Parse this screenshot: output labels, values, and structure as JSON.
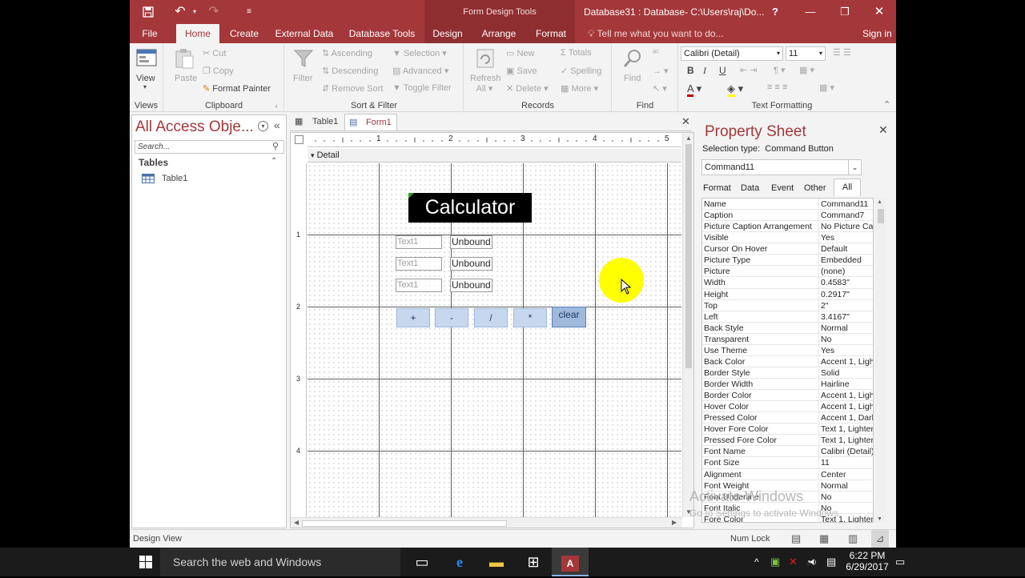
{
  "title_bar": {
    "context_label": "Form Design Tools",
    "window_title": "Database31 : Database- C:\\Users\\raj\\Do...",
    "help": "?",
    "minimize": "—",
    "restore": "❐",
    "close": "✕"
  },
  "ribbon_tabs": [
    "File",
    "Home",
    "Create",
    "External Data",
    "Database Tools",
    "Design",
    "Arrange",
    "Format"
  ],
  "tell_me": "Tell me what you want to do...",
  "sign_in": "Sign in",
  "ribbon": {
    "views": {
      "view": "View",
      "label": "Views"
    },
    "clipboard": {
      "paste": "Paste",
      "cut": "Cut",
      "copy": "Copy",
      "format_painter": "Format Painter",
      "label": "Clipboard"
    },
    "sort_filter": {
      "filter": "Filter",
      "ascending": "Ascending",
      "descending": "Descending",
      "remove_sort": "Remove Sort",
      "selection": "Selection",
      "advanced": "Advanced",
      "toggle_filter": "Toggle Filter",
      "label": "Sort & Filter"
    },
    "records": {
      "refresh": "Refresh",
      "refresh2": "All",
      "new": "New",
      "save": "Save",
      "delete": "Delete",
      "totals": "Totals",
      "spelling": "Spelling",
      "more": "More",
      "label": "Records"
    },
    "find": {
      "find": "Find",
      "label": "Find"
    },
    "text_formatting": {
      "font": "Calibri (Detail)",
      "size": "11",
      "bold": "B",
      "italic": "I",
      "underline": "U",
      "label": "Text Formatting"
    }
  },
  "nav_pane": {
    "header": "All Access Obje...",
    "search_placeholder": "Search...",
    "section": "Tables",
    "items": [
      "Table1"
    ]
  },
  "doc_tabs": [
    "Table1",
    "Form1"
  ],
  "ruler": [
    "1",
    "2",
    "3",
    "4",
    "5"
  ],
  "vruler": [
    "1",
    "2",
    "3",
    "4"
  ],
  "form": {
    "section": "Detail",
    "title_label": "Calculator",
    "labels": [
      "Text1",
      "Text1",
      "Text1"
    ],
    "textboxes": [
      "Unbound",
      "Unbound",
      "Unbound"
    ],
    "buttons": [
      "+",
      "-",
      "/",
      "*",
      "clear"
    ]
  },
  "property_sheet": {
    "title": "Property Sheet",
    "selection_type_label": "Selection type:",
    "selection_type": "Command Button",
    "selected_control": "Command11",
    "tabs": [
      "Format",
      "Data",
      "Event",
      "Other",
      "All"
    ],
    "rows": [
      [
        "Name",
        "Command11"
      ],
      [
        "Caption",
        "Command7"
      ],
      [
        "Picture Caption Arrangement",
        "No Picture Cap"
      ],
      [
        "Visible",
        "Yes"
      ],
      [
        "Cursor On Hover",
        "Default"
      ],
      [
        "Picture Type",
        "Embedded"
      ],
      [
        "Picture",
        "(none)"
      ],
      [
        "Width",
        "0.4583\""
      ],
      [
        "Height",
        "0.2917\""
      ],
      [
        "Top",
        "2\""
      ],
      [
        "Left",
        "3.4167\""
      ],
      [
        "Back Style",
        "Normal"
      ],
      [
        "Transparent",
        "No"
      ],
      [
        "Use Theme",
        "Yes"
      ],
      [
        "Back Color",
        "Accent 1, Ligh"
      ],
      [
        "Border Style",
        "Solid"
      ],
      [
        "Border Width",
        "Hairline"
      ],
      [
        "Border Color",
        "Accent 1, Ligh"
      ],
      [
        "Hover Color",
        "Accent 1, Ligh"
      ],
      [
        "Pressed Color",
        "Accent 1, Dark"
      ],
      [
        "Hover Fore Color",
        "Text 1, Lighter"
      ],
      [
        "Pressed Fore Color",
        "Text 1, Lighter"
      ],
      [
        "Font Name",
        "Calibri (Detail)"
      ],
      [
        "Font Size",
        "11"
      ],
      [
        "Alignment",
        "Center"
      ],
      [
        "Font Weight",
        "Normal"
      ],
      [
        "Font Underline",
        "No"
      ],
      [
        "Font Italic",
        "No"
      ],
      [
        "Fore Color",
        "Text 1, Lighter"
      ]
    ]
  },
  "watermark": {
    "line1": "Activate Windows",
    "line2": "Go to Settings to activate Windows."
  },
  "status_bar": {
    "left": "Design View",
    "num_lock": "Num Lock"
  },
  "taskbar": {
    "search": "Search the web and Windows",
    "time": "6:22 PM",
    "date": "6/29/2017"
  },
  "colors": {
    "accent": "#a4373a",
    "button_fill": "#c7d8ee",
    "title_label_bg": "#000000"
  }
}
